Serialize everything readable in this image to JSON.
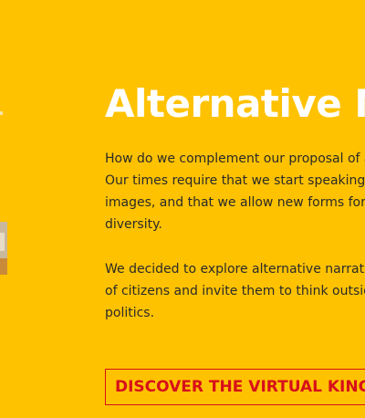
{
  "section": {
    "title": "Alternative N",
    "paragraphs": [
      {
        "lines": [
          "How do we complement our proposal of a",
          "Our times require that we start speaking",
          "images, and that we allow new forms for e",
          "diversity."
        ]
      },
      {
        "lines": [
          "We decided to explore alternative narrati",
          "of citizens and invite them to think outsid",
          "politics."
        ]
      }
    ],
    "cta_label": "DISCOVER THE VIRTUAL KING"
  },
  "colors": {
    "background": "#ffc200",
    "title": "#ffffff",
    "body_text": "#2a2a2a",
    "cta": "#d7101a"
  }
}
